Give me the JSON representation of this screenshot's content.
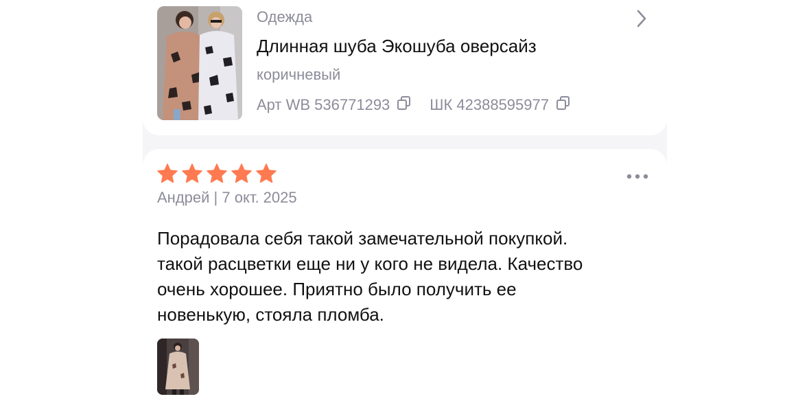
{
  "product": {
    "category": "Одежда",
    "title": "Длинная шуба Экошуба оверсайз",
    "color": "коричневый",
    "article_label": "Арт WB 536771293",
    "barcode_label": "ШК 42388595977"
  },
  "review": {
    "rating": 5,
    "rating_max": 5,
    "author_date": "Андрей | 7 окт. 2025",
    "text": "Порадовала себя такой замечательной покупкой.\nтакой расцветки еще ни у кого не видела. Качество\nочень хорошее. Приятно было получить ее\nновенькую, стояла пломба."
  },
  "colors": {
    "star": "#ff7a50",
    "muted_text": "#8c8c9a",
    "main_text": "#111111",
    "background_strip": "#f5f5f8"
  },
  "icons": {
    "chevron": "chevron-right-icon",
    "copy": "copy-icon",
    "star": "star-icon",
    "more": "more-dots-icon"
  }
}
